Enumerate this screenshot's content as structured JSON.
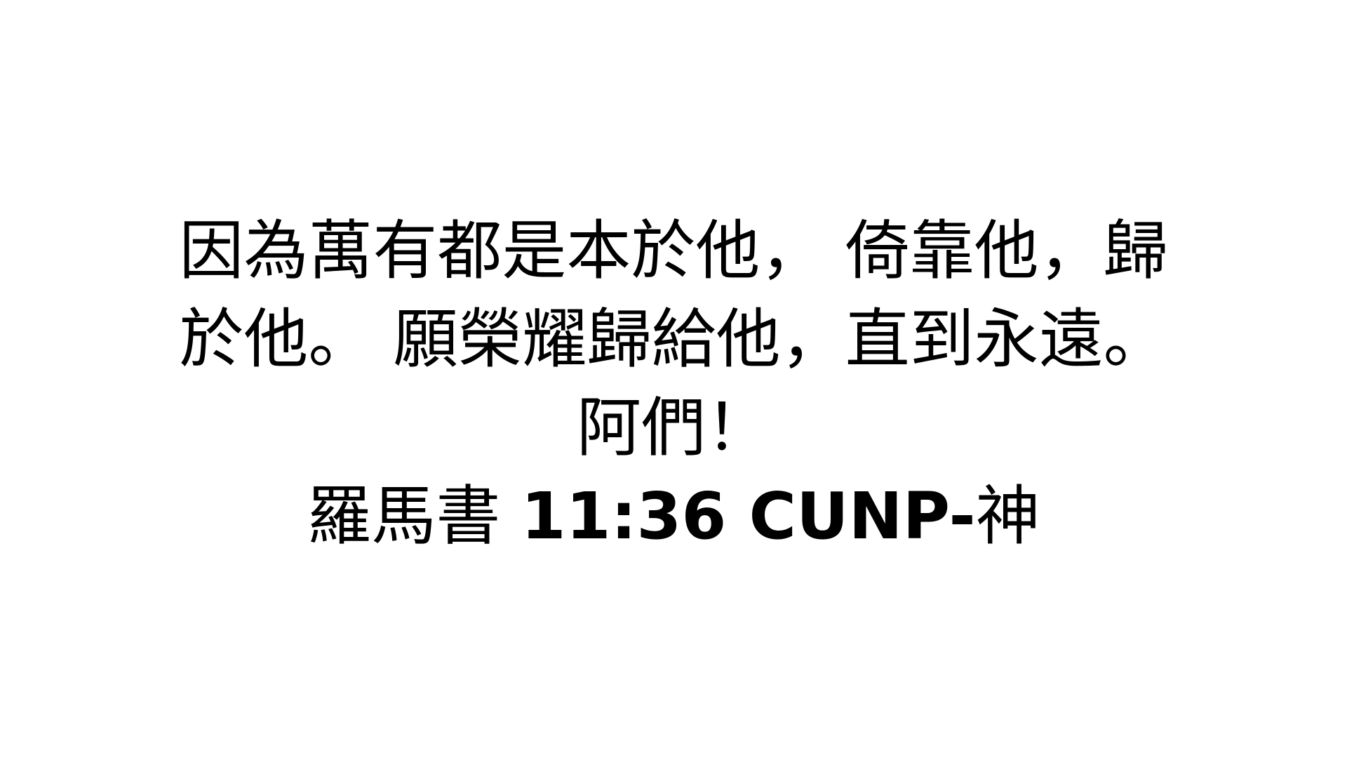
{
  "slide": {
    "background_color": "#ffffff",
    "text_color": "#000000",
    "verse_lines": [
      "因為萬有都是本於他， 倚靠他，歸",
      "於他。 願榮耀歸給他，直到永遠。",
      "阿們！"
    ],
    "reference": {
      "book": "羅馬書 ",
      "citation": "11:36 CUNP-",
      "suffix": "神"
    }
  }
}
